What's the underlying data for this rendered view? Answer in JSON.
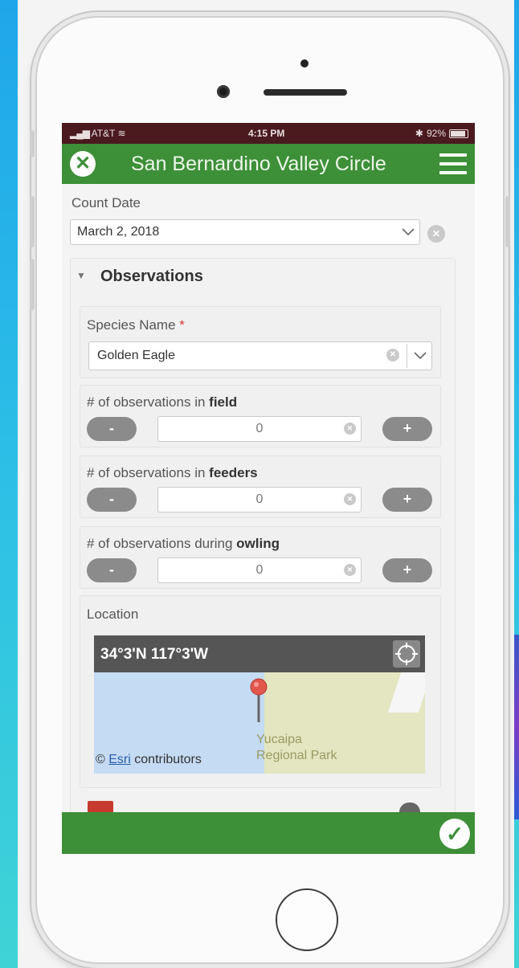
{
  "status_bar": {
    "carrier": "AT&T",
    "time": "4:15 PM",
    "battery": "92%"
  },
  "header": {
    "title": "San Bernardino Valley Circle",
    "close_icon": "close-icon",
    "menu_icon": "hamburger-menu-icon"
  },
  "form": {
    "count_date": {
      "label": "Count Date",
      "value": "March 2, 2018"
    },
    "observations": {
      "title": "Observations",
      "species": {
        "label": "Species Name",
        "required_mark": "*",
        "value": "Golden Eagle"
      },
      "fields": [
        {
          "prefix": "# of observations in ",
          "emphasis": "field",
          "value": "0",
          "minus": "-",
          "plus": "+"
        },
        {
          "prefix": "# of observations in ",
          "emphasis": "feeders",
          "value": "0",
          "minus": "-",
          "plus": "+"
        },
        {
          "prefix": "# of observations during ",
          "emphasis": "owling",
          "value": "0",
          "minus": "-",
          "plus": "+"
        }
      ]
    },
    "location": {
      "label": "Location",
      "coordinates": "34°3'N 117°3'W",
      "map_label_line1": "Yucaipa",
      "map_label_line2": "Regional Park",
      "attribution_prefix": "©",
      "attribution_link": "Esri",
      "attribution_suffix": "contributors"
    }
  },
  "colors": {
    "header_green": "#3d8f38",
    "status_bar": "#4a1a1f",
    "pin_red": "#e2574c"
  }
}
